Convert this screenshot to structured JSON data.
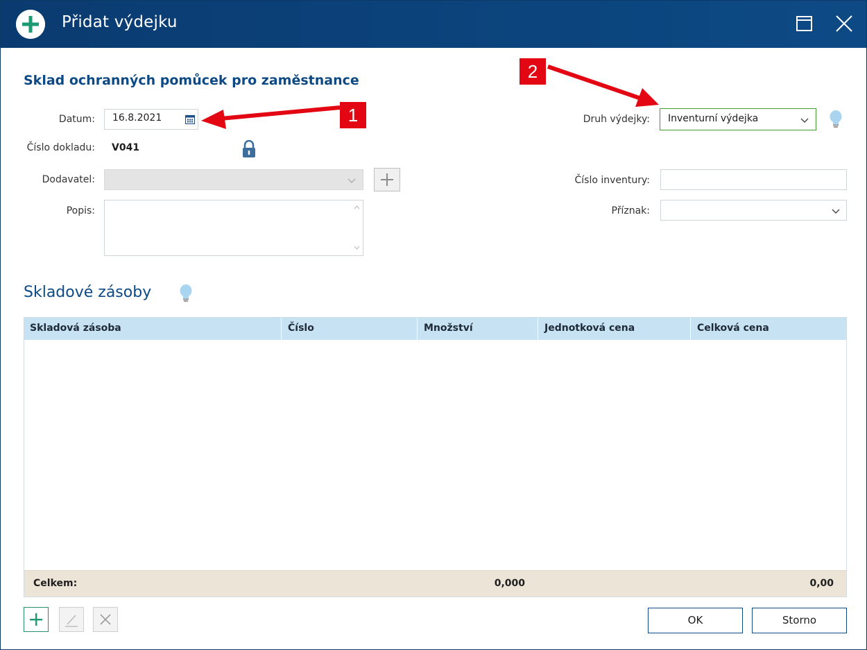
{
  "window": {
    "title": "Přidat výdejku",
    "icons": {
      "app": "plus-circle-icon",
      "maximize": "maximize-icon",
      "close": "close-icon"
    }
  },
  "form": {
    "heading": "Sklad ochranných pomůcek pro zaměstnance",
    "date_label": "Datum:",
    "date_value": "16.8.2021",
    "doc_number_label": "Číslo dokladu:",
    "doc_number_value": "V041",
    "supplier_label": "Dodavatel:",
    "supplier_value": "",
    "description_label": "Popis:",
    "description_value": "",
    "issue_type_label": "Druh výdejky:",
    "issue_type_value": "Inventurní výdejka",
    "inventory_number_label": "Číslo inventury:",
    "inventory_number_value": "",
    "flag_label": "Příznak:",
    "flag_value": ""
  },
  "stock": {
    "title": "Skladové zásoby",
    "columns": [
      "Skladová zásoba",
      "Číslo",
      "Množství",
      "Jednotková cena",
      "Celková cena"
    ],
    "rows": [],
    "footer": {
      "label": "Celkem:",
      "quantity_total": "0,000",
      "price_total": "0,00"
    }
  },
  "buttons": {
    "ok": "OK",
    "cancel": "Storno"
  },
  "annotations": {
    "marker_1": "1",
    "marker_2": "2",
    "color": "#e30613"
  },
  "colors": {
    "titlebar": "#0a3b70",
    "accent": "#0d4a85",
    "table_header": "#c7e3f3",
    "table_footer": "#ede4d8",
    "green_border": "#3f9a2f"
  }
}
